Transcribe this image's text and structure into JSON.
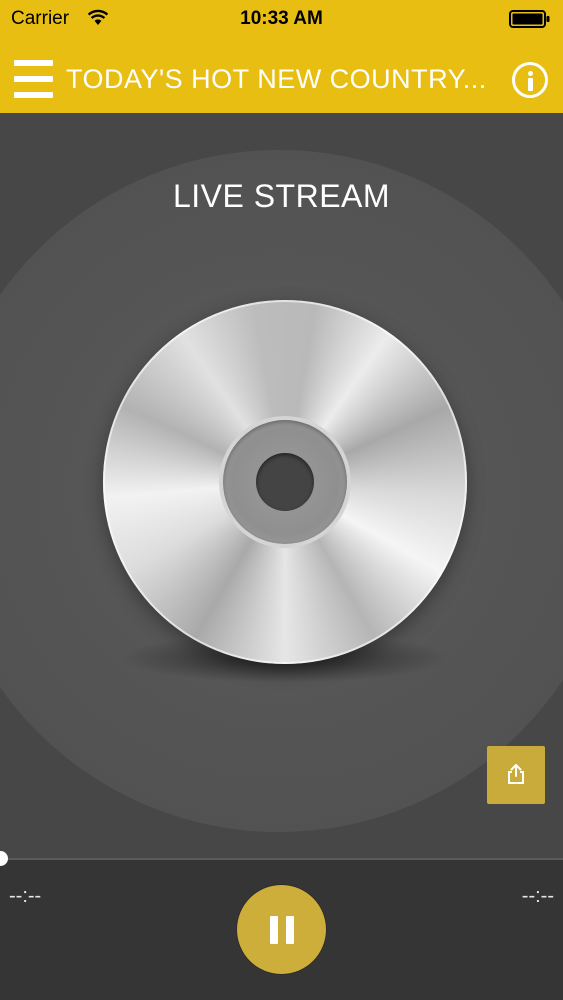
{
  "status_bar": {
    "carrier": "Carrier",
    "time": "10:33 AM",
    "wifi_icon": "wifi-icon",
    "battery_icon": "battery-icon"
  },
  "nav_bar": {
    "title": "TODAY'S HOT NEW COUNTRY...",
    "menu_icon": "hamburger-menu-icon",
    "info_icon": "info-icon",
    "background_color": "#e9be13"
  },
  "player": {
    "stream_label": "LIVE STREAM",
    "artwork_icon": "compact-disc-icon",
    "share_icon": "share-icon",
    "accent_color": "#cdae3a",
    "progress": 0,
    "time_elapsed": "--:--",
    "time_remaining": "--:--",
    "pause_icon": "pause-icon"
  }
}
